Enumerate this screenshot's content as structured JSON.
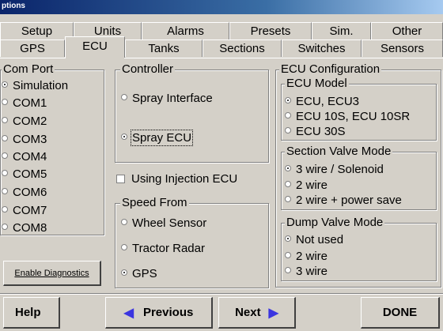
{
  "window": {
    "title": "ptions"
  },
  "tabs_row1": [
    "Setup",
    "Units",
    "Alarms",
    "Presets",
    "Sim.",
    "Other"
  ],
  "tabs_row2": [
    "GPS",
    "ECU",
    "Tanks",
    "Sections",
    "Switches",
    "Sensors"
  ],
  "active_tab": "ECU",
  "com_port": {
    "legend": "Com Port",
    "options": [
      "Simulation",
      "COM1",
      "COM2",
      "COM3",
      "COM4",
      "COM5",
      "COM6",
      "COM7",
      "COM8"
    ],
    "selected": "Simulation"
  },
  "controller": {
    "legend": "Controller",
    "options": [
      "Spray Interface",
      "Spray ECU"
    ],
    "selected": "Spray ECU"
  },
  "injection": {
    "label": "Using Injection ECU",
    "checked": false
  },
  "speed_from": {
    "legend": "Speed From",
    "options": [
      "Wheel Sensor",
      "Tractor Radar",
      "GPS"
    ],
    "selected": "GPS"
  },
  "ecu_config": {
    "legend": "ECU Configuration",
    "ecu_model": {
      "legend": "ECU Model",
      "options": [
        "ECU, ECU3",
        "ECU 10S, ECU 10SR",
        "ECU 30S"
      ],
      "selected": "ECU, ECU3"
    },
    "section_valve_mode": {
      "legend": "Section Valve Mode",
      "options": [
        "3 wire / Solenoid",
        "2 wire",
        "2 wire + power save"
      ],
      "selected": "3 wire / Solenoid"
    },
    "dump_valve_mode": {
      "legend": "Dump Valve Mode",
      "options": [
        "Not used",
        "2 wire",
        "3 wire"
      ],
      "selected": "Not used"
    }
  },
  "diagnostics_button": "Enable Diagnostics",
  "footer": {
    "help": "Help",
    "previous_arrow": "◀",
    "previous": "Previous",
    "next": "Next",
    "next_arrow": "▶",
    "done": "DONE"
  }
}
